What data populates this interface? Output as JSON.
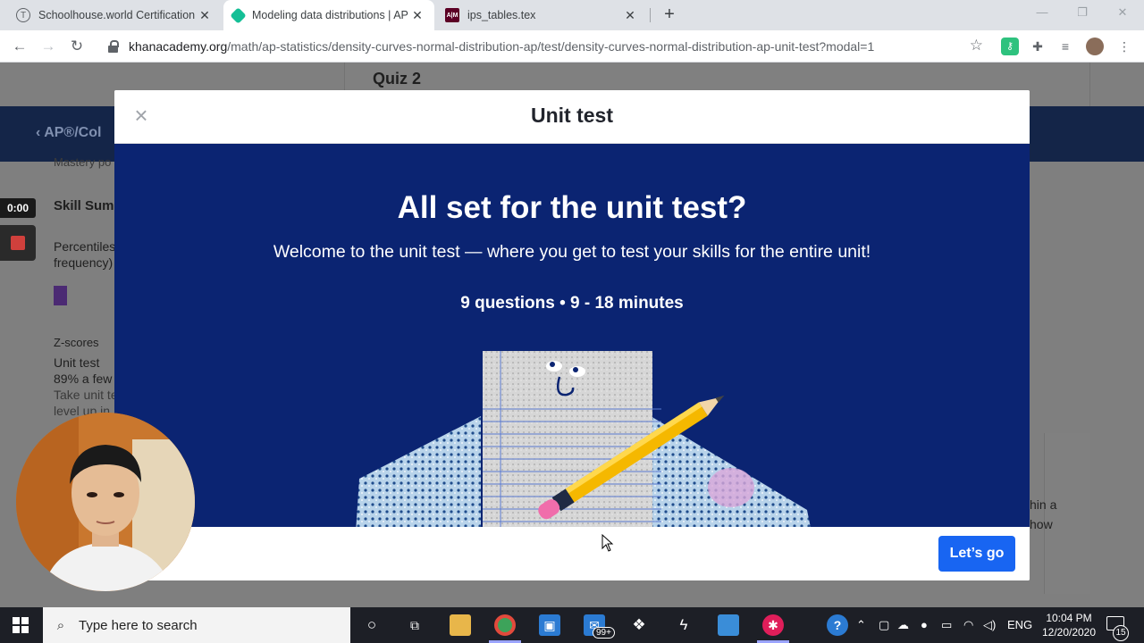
{
  "browser": {
    "tabs": [
      {
        "icon_letter": "T",
        "title": "Schoolhouse.world Certification S",
        "active": false
      },
      {
        "icon_letter": "",
        "title": "Modeling data distributions | AP",
        "active": true
      },
      {
        "icon_letter": "A|M",
        "title": "ips_tables.tex",
        "active": false
      }
    ],
    "url_host": "khanacademy.org",
    "url_path": "/math/ap-statistics/density-curves-normal-distribution-ap/test/density-curves-normal-distribution-ap-unit-test?modal=1"
  },
  "background_page": {
    "quiz_heading": "Quiz 2",
    "course_back": "AP®/Col",
    "mastery_text": "Mastery po",
    "skill_summary": "Skill Summ",
    "percentiles": "Percentiles",
    "frequency": "frequency)",
    "zscores": "Z-scores",
    "unit_test_label": "Unit test",
    "unit_test_pct": "89% a few",
    "take_unit": "Take unit te",
    "level_up": "level up in",
    "right_frag1": "hin a",
    "right_frag2": "how"
  },
  "modal": {
    "close_symbol": "×",
    "title": "Unit test",
    "hero_title": "All set for the unit test?",
    "hero_subtitle": "Welcome to the unit test — where you get to test your skills for the entire unit!",
    "meta": "9 questions • 9 - 18 minutes",
    "cta_label": "Let’s go"
  },
  "recorder": {
    "timer": "0:00"
  },
  "taskbar": {
    "search_placeholder": "Type here to search",
    "mail_badge": "99+",
    "language": "ENG",
    "time": "10:04 PM",
    "date": "12/20/2020",
    "notification_count": "15"
  },
  "colors": {
    "modal_body_bg": "#0b2472",
    "cta_blue": "#1865f2",
    "header_band": "#142548",
    "overlay_gray": "#7f7f7f"
  }
}
